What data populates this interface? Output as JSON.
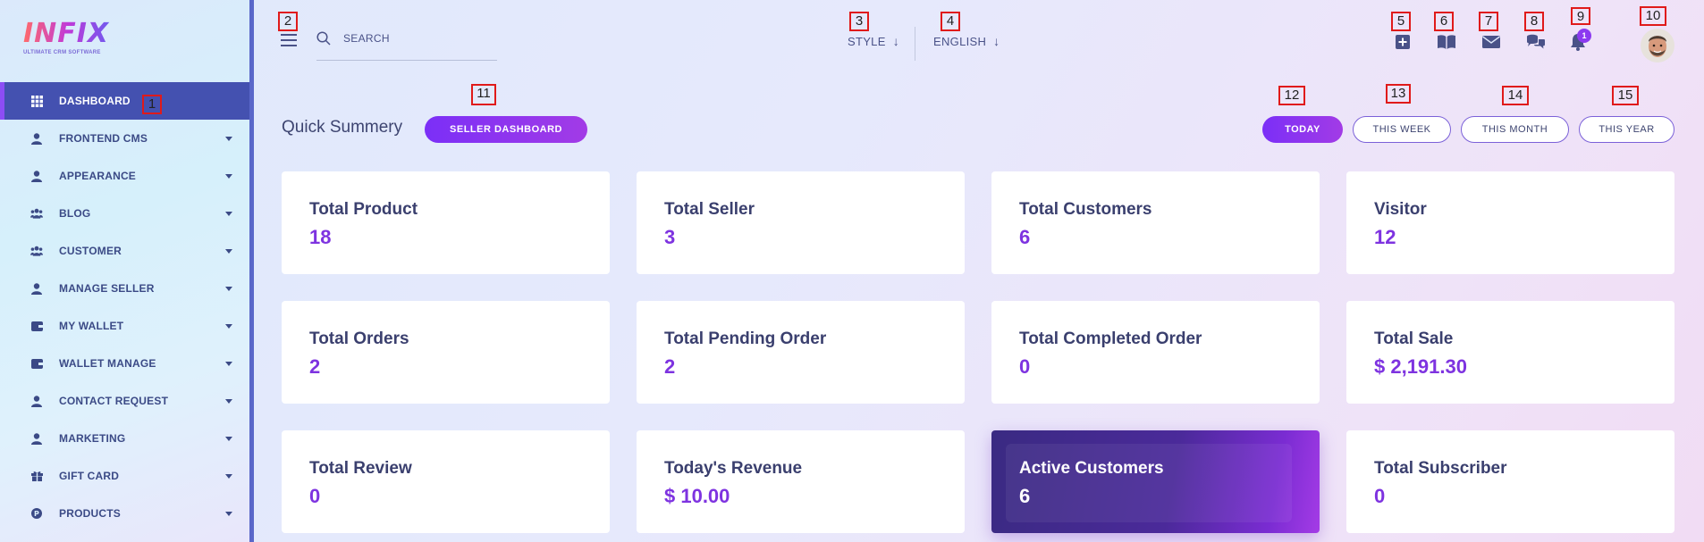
{
  "logo": {
    "name": "INFIX",
    "tagline": "ULTIMATE CRM SOFTWARE"
  },
  "sidebar": {
    "items": [
      {
        "label": "DASHBOARD",
        "icon": "grid-icon",
        "active": true
      },
      {
        "label": "FRONTEND CMS",
        "icon": "user-icon"
      },
      {
        "label": "APPEARANCE",
        "icon": "user-icon"
      },
      {
        "label": "BLOG",
        "icon": "users-icon"
      },
      {
        "label": "CUSTOMER",
        "icon": "users-icon"
      },
      {
        "label": "MANAGE SELLER",
        "icon": "user-icon"
      },
      {
        "label": "MY WALLET",
        "icon": "wallet-icon"
      },
      {
        "label": "WALLET MANAGE",
        "icon": "wallet-icon"
      },
      {
        "label": "CONTACT REQUEST",
        "icon": "user-icon"
      },
      {
        "label": "MARKETING",
        "icon": "user-icon"
      },
      {
        "label": "GIFT CARD",
        "icon": "gift-icon"
      },
      {
        "label": "PRODUCTS",
        "icon": "product-icon"
      }
    ]
  },
  "header": {
    "search_placeholder": "SEARCH",
    "style_label": "STYLE",
    "language_label": "ENGLISH",
    "notification_count": "1"
  },
  "markers": [
    "1",
    "2",
    "3",
    "4",
    "5",
    "6",
    "7",
    "8",
    "9",
    "10",
    "11",
    "12",
    "13",
    "14",
    "15"
  ],
  "summary": {
    "title": "Quick Summery",
    "seller_dashboard": "SELLER DASHBOARD",
    "periods": [
      "TODAY",
      "THIS WEEK",
      "THIS MONTH",
      "THIS YEAR"
    ],
    "active_period": "TODAY"
  },
  "cards": [
    {
      "title": "Total Product",
      "value": "18"
    },
    {
      "title": "Total Seller",
      "value": "3"
    },
    {
      "title": "Total Customers",
      "value": "6"
    },
    {
      "title": "Visitor",
      "value": "12"
    },
    {
      "title": "Total Orders",
      "value": "2"
    },
    {
      "title": "Total Pending Order",
      "value": "2"
    },
    {
      "title": "Total Completed Order",
      "value": "0"
    },
    {
      "title": "Total Sale",
      "value": "$ 2,191.30"
    },
    {
      "title": "Total Review",
      "value": "0"
    },
    {
      "title": "Today's Revenue",
      "value": "$ 10.00"
    },
    {
      "title": "Active Customers",
      "value": "6",
      "highlighted": true
    },
    {
      "title": "Total Subscriber",
      "value": "0"
    }
  ],
  "colors": {
    "accent": "#7b2ff7",
    "sidebar_active": "#4451b0",
    "value_purple": "#7e33e0",
    "marker_red": "#e01a1a"
  }
}
